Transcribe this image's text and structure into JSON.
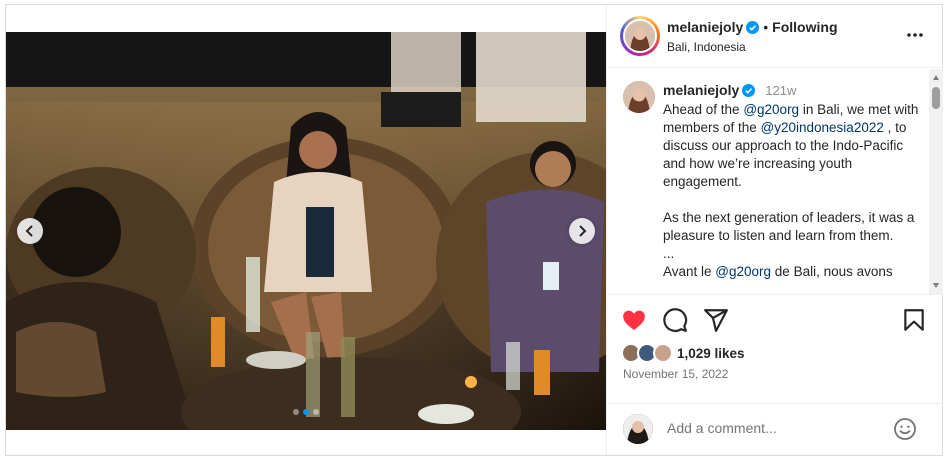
{
  "post": {
    "username": "melaniejoly",
    "follow_separator": "•",
    "follow_status": "Following",
    "location": "Bali, Indonesia",
    "more_icon": "more-horizontal-icon",
    "verified_color": "#0095f6"
  },
  "media": {
    "carousel": {
      "total": 3,
      "active_index": 1
    },
    "prev_icon": "chevron-left-icon",
    "next_icon": "chevron-right-icon"
  },
  "caption": {
    "username": "melaniejoly",
    "age": "121w",
    "t1": "Ahead of the ",
    "m1": "@g20org",
    "t2": " in Bali, we met with members of the ",
    "m2": "@y20indonesia2022",
    "t3": " , to discuss our approach to the Indo-Pacific and how we’re increasing youth engagement.",
    "p2": "As the next generation of leaders, it was a pleasure to listen and learn from them.",
    "p3": "...",
    "t4": "Avant le ",
    "m3": "@g20org",
    "t5": " de Bali, nous avons"
  },
  "actions": {
    "like_icon": "heart-filled-icon",
    "comment_icon": "comment-icon",
    "share_icon": "send-icon",
    "save_icon": "bookmark-icon",
    "like_color": "#ff3040"
  },
  "likes": {
    "text": "1,029 likes"
  },
  "date": {
    "text": "November 15, 2022"
  },
  "comment": {
    "placeholder": "Add a comment...",
    "emoji_icon": "smiley-icon"
  }
}
